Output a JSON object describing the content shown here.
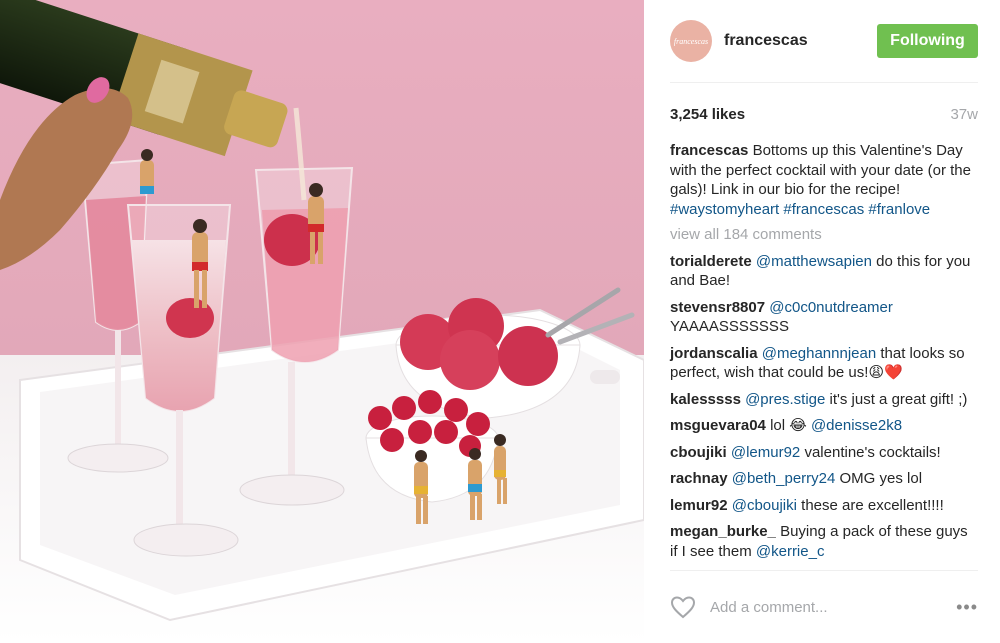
{
  "post": {
    "username": "francescas",
    "avatar_text": "francescas",
    "follow_label": "Following",
    "likes": "3,254 likes",
    "time": "37w"
  },
  "caption": {
    "user": "francescas",
    "text": "Bottoms up this Valentine's Day with the perfect cocktail with your date (or the gals)! Link in our bio for the recipe!",
    "hashtags": "#waystomyheart #francescas #franlove"
  },
  "view_all": "view all 184 comments",
  "comments": [
    {
      "user": "torialderete",
      "mention": "@matthewsapien",
      "text": "do this for you and Bae!"
    },
    {
      "user": "stevensr8807",
      "mention": "@c0c0nutdreamer",
      "text": "YAAAASSSSSSS"
    },
    {
      "user": "jordanscalia",
      "mention": "@meghannnjean",
      "text": "that looks so perfect, wish that could be us!😩❤️"
    },
    {
      "user": "kalesssss",
      "mention": "@pres.stige",
      "text": "it's just a great gift! ;)"
    },
    {
      "user": "msguevara04",
      "pre": "lol 😂",
      "mention": "@denisse2k8",
      "text": ""
    },
    {
      "user": "cboujiki",
      "mention": "@lemur92",
      "text": "valentine's cocktails!"
    },
    {
      "user": "rachnay",
      "mention": "@beth_perry24",
      "text": "OMG yes lol"
    },
    {
      "user": "lemur92",
      "mention": "@cboujiki",
      "text": "these are excellent!!!!"
    },
    {
      "user": "megan_burke_",
      "text": "Buying a pack of these guys if I see them",
      "mention_after": "@kerrie_c"
    }
  ],
  "footer": {
    "add_comment_placeholder": "Add a comment...",
    "more_icon": "•••"
  },
  "colors": {
    "follow_green": "#70c050",
    "link_blue": "#125688",
    "muted_gray": "#a5a7aa",
    "photo_pink": "#e7aebf"
  }
}
